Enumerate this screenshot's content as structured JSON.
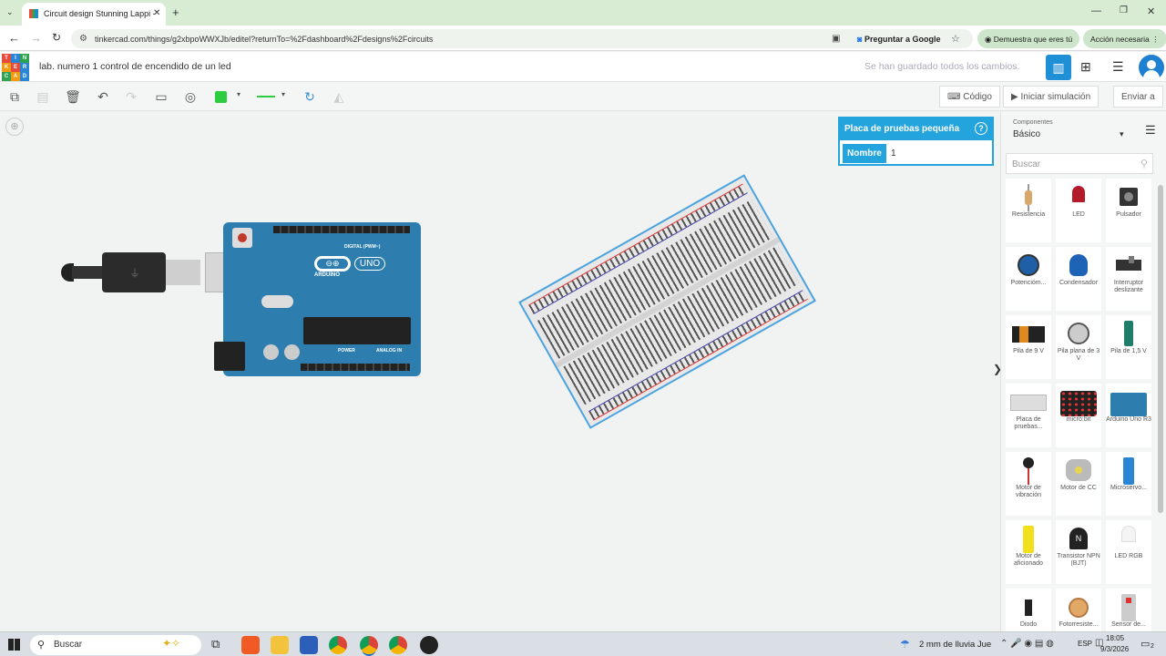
{
  "browser": {
    "tab_title": "Circuit design Stunning Lappi -",
    "url": "tinkercad.com/things/g2xbpoWWXJb/editel?returnTo=%2Fdashboard%2Fdesigns%2Fcircuits",
    "ask_google": "Preguntar a Google",
    "prove_human": "Demuestra que eres tú",
    "action_required": "Acción necesaria"
  },
  "app": {
    "logo_letters": [
      "T",
      "I",
      "N",
      "K",
      "E",
      "R",
      "C",
      "A",
      "D"
    ],
    "title": "lab. numero 1 control de encendido de un led",
    "save_status": "Se han guardado todos los cambios.",
    "code_label": "Código",
    "simulate_label": "Iniciar simulación",
    "send_label": "Enviar a",
    "color_swatch": "#2ecc40"
  },
  "inspector": {
    "title": "Placa de pruebas pequeña",
    "name_label": "Nombre",
    "name_value": "1"
  },
  "canvas": {
    "arduino_brand": "ARDUINO",
    "arduino_model": "UNO",
    "digital_label": "DIGITAL (PWM~)",
    "power_label": "POWER",
    "analog_label": "ANALOG IN"
  },
  "sidebar": {
    "components_label": "Componentes",
    "category": "Básico",
    "search_placeholder": "Buscar",
    "items": [
      {
        "label": "Resistencia",
        "icon": "resistor-icon"
      },
      {
        "label": "LED",
        "icon": "led-icon"
      },
      {
        "label": "Pulsador",
        "icon": "pushbutton-icon"
      },
      {
        "label": "Potencióm...",
        "icon": "potentiometer-icon"
      },
      {
        "label": "Condensador",
        "icon": "capacitor-icon"
      },
      {
        "label": "Interruptor deslizante",
        "icon": "slide-switch-icon"
      },
      {
        "label": "Pila de 9 V",
        "icon": "battery-9v-icon"
      },
      {
        "label": "Pila plana de 3 V",
        "icon": "coin-cell-icon"
      },
      {
        "label": "Pila de 1,5 V",
        "icon": "battery-aa-icon"
      },
      {
        "label": "Placa de pruebas...",
        "icon": "breadboard-icon"
      },
      {
        "label": "micro:bit",
        "icon": "microbit-icon"
      },
      {
        "label": "Arduino Uno R3",
        "icon": "arduino-icon"
      },
      {
        "label": "Motor de vibración",
        "icon": "vibration-motor-icon"
      },
      {
        "label": "Motor de CC",
        "icon": "dc-motor-icon"
      },
      {
        "label": "Microservo...",
        "icon": "microservo-icon"
      },
      {
        "label": "Motor de aficionado",
        "icon": "hobby-motor-icon"
      },
      {
        "label": "Transistor NPN (BJT)",
        "icon": "transistor-icon"
      },
      {
        "label": "LED RGB",
        "icon": "rgb-led-icon"
      },
      {
        "label": "Diodo",
        "icon": "diode-icon"
      },
      {
        "label": "Fotorresiste...",
        "icon": "photoresistor-icon"
      },
      {
        "label": "Sensor de...",
        "icon": "sensor-icon"
      }
    ]
  },
  "taskbar": {
    "search": "Buscar",
    "weather": "2 mm de lluvia Jue",
    "lang": "ESP",
    "time": "18:05",
    "date": "9/3/2026",
    "notifications": "2"
  }
}
